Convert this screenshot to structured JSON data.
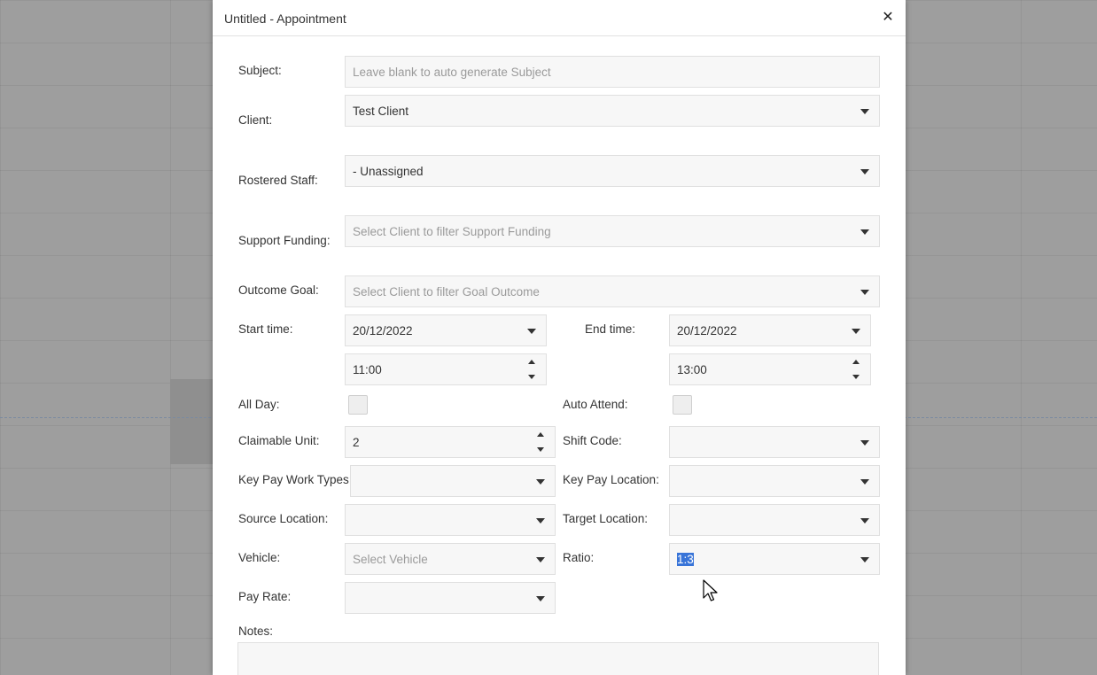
{
  "dialog": {
    "title": "Untitled - Appointment"
  },
  "form": {
    "subject": {
      "label": "Subject:",
      "placeholder": "Leave blank to auto generate Subject"
    },
    "client": {
      "label": "Client:",
      "value": "Test Client"
    },
    "rostered_staff": {
      "label": "Rostered Staff:",
      "value": "- Unassigned"
    },
    "support_funding": {
      "label": "Support Funding:",
      "placeholder": "Select Client to filter Support Funding"
    },
    "outcome_goal": {
      "label": "Outcome Goal:",
      "placeholder": "Select Client to filter Goal Outcome"
    },
    "start_time": {
      "label": "Start time:",
      "date": "20/12/2022",
      "time": "11:00"
    },
    "end_time": {
      "label": "End time:",
      "date": "20/12/2022",
      "time": "13:00"
    },
    "all_day": {
      "label": "All Day:",
      "checked": false
    },
    "auto_attend": {
      "label": "Auto Attend:",
      "checked": false
    },
    "claimable_unit": {
      "label": "Claimable Unit:",
      "value": "2"
    },
    "shift_code": {
      "label": "Shift Code:",
      "value": ""
    },
    "key_pay_work_types": {
      "label": "Key Pay Work Types:",
      "value": ""
    },
    "key_pay_location": {
      "label": "Key Pay Location:",
      "value": ""
    },
    "source_location": {
      "label": "Source Location:",
      "value": ""
    },
    "target_location": {
      "label": "Target Location:",
      "value": ""
    },
    "vehicle": {
      "label": "Vehicle:",
      "placeholder": "Select Vehicle"
    },
    "ratio": {
      "label": "Ratio:",
      "value": "1:3"
    },
    "pay_rate": {
      "label": "Pay Rate:",
      "value": ""
    },
    "notes": {
      "label": "Notes:",
      "value": ""
    }
  },
  "icons": {
    "close": "close-icon",
    "dropdown": "chevron-down-icon",
    "spinner": "spinner-arrows-icon",
    "cursor": "mouse-pointer-icon"
  },
  "colors": {
    "selection": "#3874d8",
    "overlay": "#9e9e9e"
  }
}
